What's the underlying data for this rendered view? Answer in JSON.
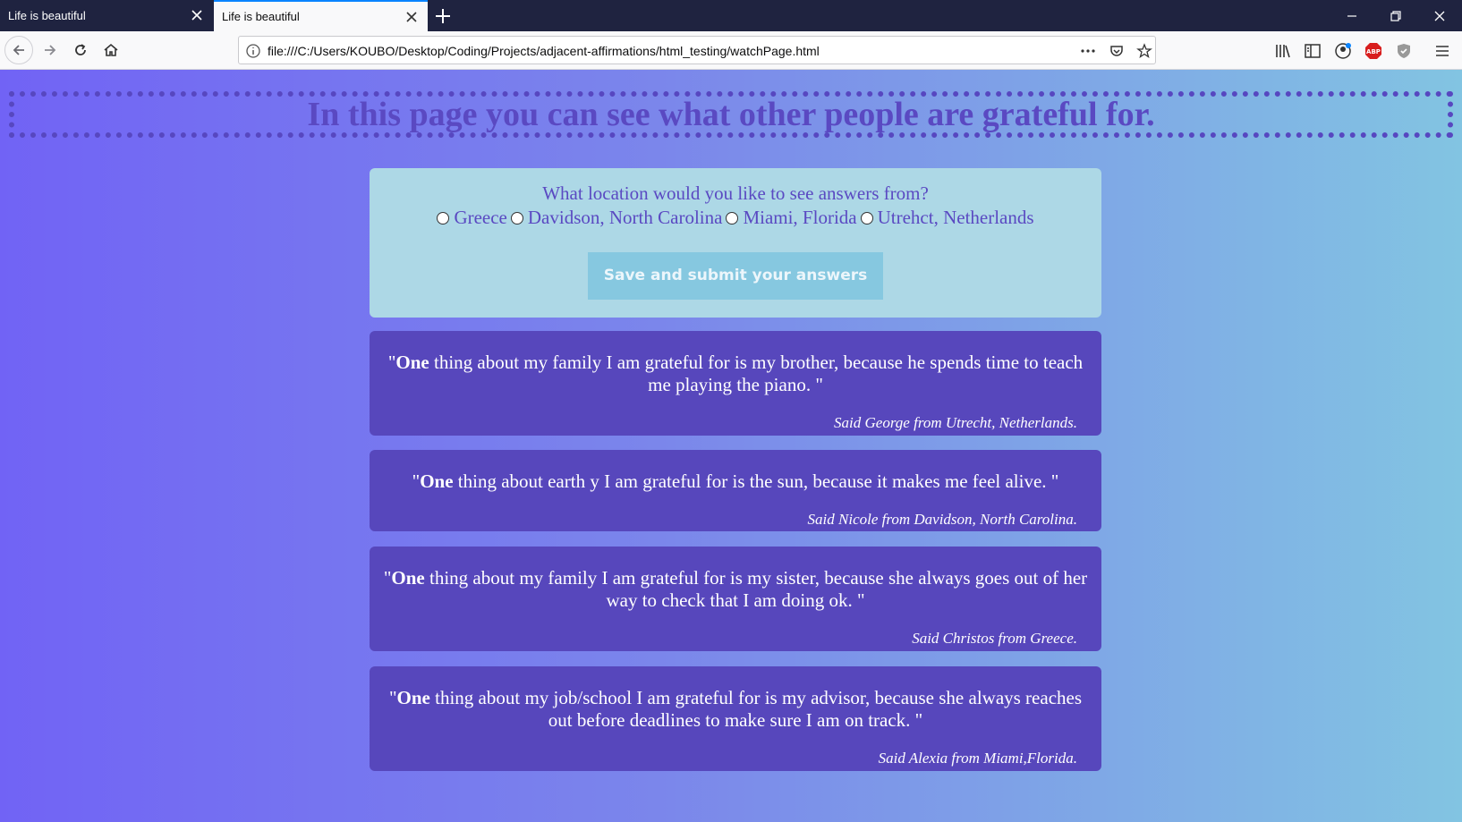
{
  "browser": {
    "tabs": [
      {
        "title": "Life is beautiful",
        "active": false
      },
      {
        "title": "Life is beautiful",
        "active": true
      }
    ],
    "url": "file:///C:/Users/KOUBO/Desktop/Coding/Projects/adjacent-affirmations/html_testing/watchPage.html",
    "accent_color": "#0a84ff"
  },
  "page": {
    "banner_title": "In this page you can see what other people are grateful for.",
    "question": {
      "prompt": "What location would you like to see answers from?",
      "options": [
        "Greece",
        "Davidson, North Carolina",
        "Miami, Florida",
        "Utrehct, Netherlands"
      ],
      "submit_label": "Save and submit your answers"
    },
    "answers": [
      {
        "lead": "One",
        "quote_open": "\"",
        "text": " thing about my family I am grateful for is my brother, because he spends time to teach me playing the piano. \"",
        "by": "Said George from Utrecht, Netherlands."
      },
      {
        "lead": "One",
        "quote_open": "\"",
        "text": " thing about earth y I am grateful for is the sun, because it makes me feel alive. \"",
        "by": "Said Nicole from Davidson, North Carolina."
      },
      {
        "lead": "One",
        "quote_open": "\"",
        "text": " thing about my family I am grateful for is my sister, because she always goes out of her way to check that I am doing ok. \"",
        "by": "Said Christos from Greece."
      },
      {
        "lead": "One",
        "quote_open": "\"",
        "text": " thing about my job/school I am grateful for is my advisor, because she always reaches out before deadlines to make sure I am on track. \"",
        "by": "Said Alexia from Miami,Florida."
      }
    ],
    "colors": {
      "banner_text": "#5a49c2",
      "card_bg": "#5747bc",
      "question_bg": "#add8e6",
      "button_bg": "#86c8e0"
    }
  }
}
